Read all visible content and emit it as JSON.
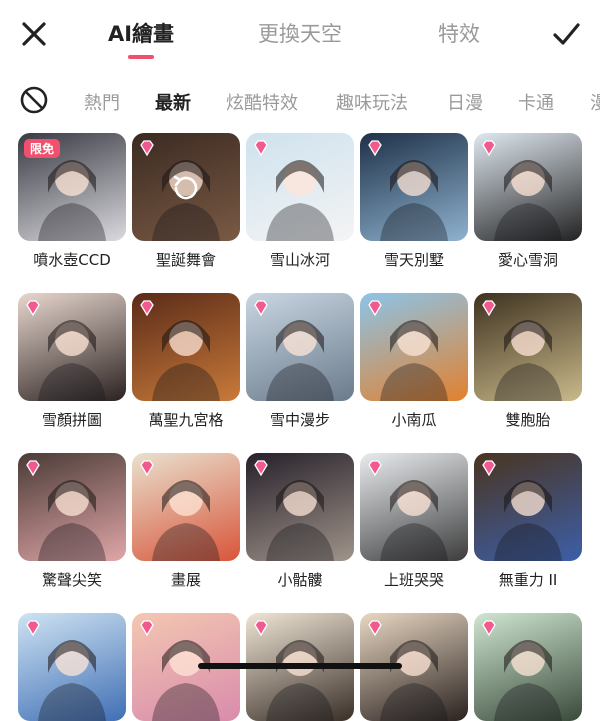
{
  "header": {
    "tabs": [
      {
        "label": "AI繪畫",
        "active": true
      },
      {
        "label": "更換天空",
        "active": false
      },
      {
        "label": "特效",
        "active": false
      }
    ],
    "close_icon": "close-icon",
    "confirm_icon": "checkmark-icon"
  },
  "categories": [
    {
      "label": "熱門",
      "active": false
    },
    {
      "label": "最新",
      "active": true
    },
    {
      "label": "炫酷特效",
      "active": false
    },
    {
      "label": "趣味玩法",
      "active": false
    },
    {
      "label": "日漫",
      "active": false
    },
    {
      "label": "卡通",
      "active": false
    },
    {
      "label": "漫",
      "active": false
    }
  ],
  "none_icon": "no-effect-icon",
  "effects": [
    {
      "label": "噴水壺CCD",
      "badge": "限免",
      "colors": [
        "#3a3a44",
        "#d9d9de"
      ]
    },
    {
      "label": "聖誕舞會",
      "badge": "",
      "colors": [
        "#3b2a22",
        "#7a5a44"
      ]
    },
    {
      "label": "雪山冰河",
      "badge": "",
      "colors": [
        "#cfe2ee",
        "#f4f4f4"
      ]
    },
    {
      "label": "雪天別墅",
      "badge": "",
      "colors": [
        "#1e3148",
        "#8fb2cf"
      ]
    },
    {
      "label": "愛心雪洞",
      "badge": "",
      "colors": [
        "#dfe8f0",
        "#222"
      ]
    },
    {
      "label": "雪顏拼圖",
      "badge": "",
      "colors": [
        "#e8d7cf",
        "#2b2220"
      ]
    },
    {
      "label": "萬聖九宮格",
      "badge": "",
      "colors": [
        "#5a2b18",
        "#c97a3a"
      ]
    },
    {
      "label": "雪中漫步",
      "badge": "",
      "colors": [
        "#c9d6e2",
        "#6a7b8c"
      ]
    },
    {
      "label": "小南瓜",
      "badge": "",
      "colors": [
        "#8cc4e8",
        "#e2812e"
      ]
    },
    {
      "label": "雙胞胎",
      "badge": "",
      "colors": [
        "#3e3220",
        "#c9b98a"
      ]
    },
    {
      "label": "驚聲尖笑",
      "badge": "",
      "colors": [
        "#4a3b36",
        "#e0a6a8"
      ]
    },
    {
      "label": "畫展",
      "badge": "",
      "colors": [
        "#e9e1cf",
        "#d8553a"
      ]
    },
    {
      "label": "小骷髏",
      "badge": "",
      "colors": [
        "#26202a",
        "#a0948a"
      ]
    },
    {
      "label": "上班哭哭",
      "badge": "",
      "colors": [
        "#e9ecef",
        "#3c3c3c"
      ]
    },
    {
      "label": "無重力 II",
      "badge": "",
      "colors": [
        "#4a3420",
        "#3c5fa8"
      ]
    },
    {
      "label": "",
      "badge": "",
      "colors": [
        "#cfe3f2",
        "#3f6fb5"
      ]
    },
    {
      "label": "",
      "badge": "",
      "colors": [
        "#f3c7b2",
        "#d98bab"
      ]
    },
    {
      "label": "",
      "badge": "",
      "colors": [
        "#efe6d6",
        "#3a2f28"
      ]
    },
    {
      "label": "",
      "badge": "",
      "colors": [
        "#e8d7c2",
        "#2a2220"
      ]
    },
    {
      "label": "",
      "badge": "",
      "colors": [
        "#cfe6d2",
        "#3a4a3a"
      ]
    }
  ],
  "accent": "#f0506e",
  "gem_icon": "premium-diamond-icon",
  "refresh_icon": "refresh-icon"
}
